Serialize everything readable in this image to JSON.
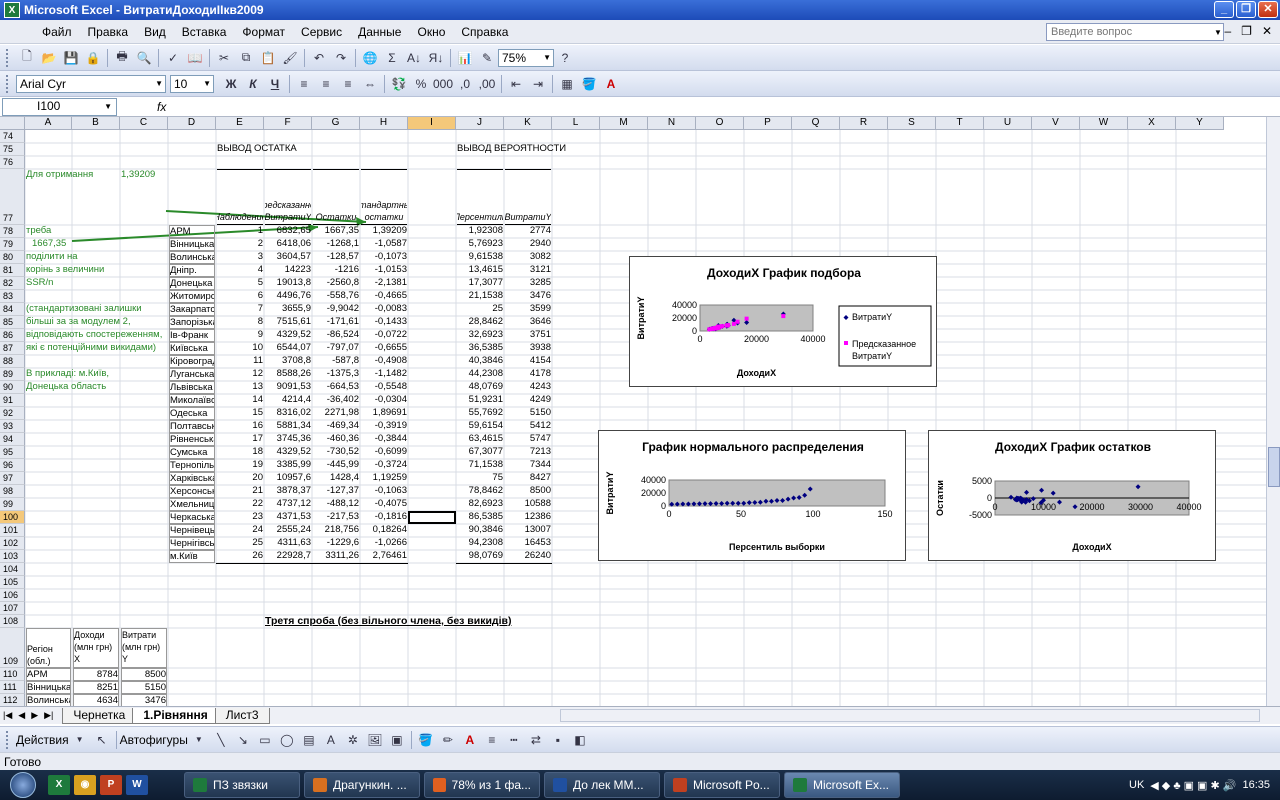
{
  "window": {
    "title": "Microsoft Excel - ВитратиДоходиІІкв2009"
  },
  "menu": [
    "Файл",
    "Правка",
    "Вид",
    "Вставка",
    "Формат",
    "Сервис",
    "Данные",
    "Окно",
    "Справка"
  ],
  "help": {
    "placeholder": "Введите вопрос"
  },
  "toolbar": {
    "zoom": "75%",
    "font": "Arial Cyr",
    "size": "10",
    "bold": "Ж",
    "italic": "К",
    "underline": "Ч"
  },
  "formula": {
    "namebox": "I100",
    "fx": "fx",
    "content": ""
  },
  "columns": [
    "A",
    "B",
    "C",
    "D",
    "E",
    "F",
    "G",
    "H",
    "I",
    "J",
    "K",
    "L",
    "M",
    "N",
    "O",
    "P",
    "Q",
    "R",
    "S",
    "T",
    "U",
    "V",
    "W",
    "X",
    "Y"
  ],
  "rows": [
    "74",
    "75",
    "76",
    "77",
    "78",
    "79",
    "80",
    "81",
    "82",
    "83",
    "84",
    "85",
    "86",
    "87",
    "88",
    "89",
    "90",
    "91",
    "92",
    "93",
    "94",
    "95",
    "96",
    "97",
    "98",
    "99",
    "100",
    "101",
    "102",
    "103",
    "104",
    "105",
    "106",
    "107",
    "108",
    "109",
    "110",
    "111",
    "112"
  ],
  "sheet": {
    "vyvod_ostatka": "ВЫВОД ОСТАТКА",
    "vyvod_veroyatnosti": "ВЫВОД ВЕРОЯТНОСТИ",
    "hdr_nabl": "Наблюдение",
    "hdr_pred": "Предсказанное ВитратиY",
    "hdr_ost": "Остатки",
    "hdr_std": "Стандартные остатки",
    "hdr_pers": "Персентиль",
    "hdr_vitr": "ВитратиY",
    "note": [
      "Для отримання",
      "треба",
      "поділити на",
      "корінь з величини",
      "SSR/n",
      "(стандартизовані залишки",
      " більші за за модулем 2,",
      "відповідають спостереженням,",
      "які є потенційними викидами)",
      "",
      "",
      "В прикладі: м.Київ,",
      "Донецька область"
    ],
    "note_b77": "1,39209",
    "note_a79": "1667,35",
    "regions": [
      "АРМ",
      "Вінницька",
      "Волинська",
      "Дніпр.",
      "Донецька",
      "Житомирська",
      "Закарпатська",
      "Запорізька",
      "Ів-Франк",
      "Київська",
      "Кіровоград",
      "Луганська",
      "Львівська",
      "Миколаївська",
      "Одеська",
      "Полтавська",
      "Рівненська",
      "Сумська",
      "Тернопільська",
      "Харківська",
      "Херсонська",
      "Хмельницька",
      "Черкаська",
      "Чернівецька",
      "Чернігівська",
      "м.Київ"
    ],
    "nabl": [
      "1",
      "2",
      "3",
      "4",
      "5",
      "6",
      "7",
      "8",
      "9",
      "10",
      "11",
      "12",
      "13",
      "14",
      "15",
      "16",
      "17",
      "18",
      "19",
      "20",
      "21",
      "22",
      "23",
      "24",
      "25",
      "26"
    ],
    "pred": [
      "6832,65",
      "6418,06",
      "3604,57",
      "14223",
      "19013,8",
      "4496,76",
      "3655,9",
      "7515,61",
      "4329,52",
      "6544,07",
      "3708,8",
      "8588,26",
      "9091,53",
      "4214,4",
      "8316,02",
      "5881,34",
      "3745,36",
      "4329,52",
      "3385,99",
      "10957,6",
      "3878,37",
      "4737,12",
      "4371,53",
      "2555,24",
      "4311,63",
      "22928,7"
    ],
    "ost": [
      "1667,35",
      "-1268,1",
      "-128,57",
      "-1216",
      "-2560,8",
      "-558,76",
      "-9,9042",
      "-171,61",
      "-86,524",
      "-797,07",
      "-587,8",
      "-1375,3",
      "-664,53",
      "-36,402",
      "2271,98",
      "-469,34",
      "-460,36",
      "-730,52",
      "-445,99",
      "1428,4",
      "-127,37",
      "-488,12",
      "-217,53",
      "218,756",
      "-1229,6",
      "3311,26"
    ],
    "std": [
      "1,39209",
      "-1,0587",
      "-0,1073",
      "-1,0153",
      "-2,1381",
      "-0,4665",
      "-0,0083",
      "-0,1433",
      "-0,0722",
      "-0,6655",
      "-0,4908",
      "-1,1482",
      "-0,5548",
      "-0,0304",
      "1,89691",
      "-0,3919",
      "-0,3844",
      "-0,6099",
      "-0,3724",
      "1,19259",
      "-0,1063",
      "-0,4075",
      "-0,1816",
      "0,18264",
      "-1,0266",
      "2,76461"
    ],
    "pers": [
      "1,92308",
      "5,76923",
      "9,61538",
      "13,4615",
      "17,3077",
      "21,1538",
      "25",
      "28,8462",
      "32,6923",
      "36,5385",
      "40,3846",
      "44,2308",
      "48,0769",
      "51,9231",
      "55,7692",
      "59,6154",
      "63,4615",
      "67,3077",
      "71,1538",
      "75",
      "78,8462",
      "82,6923",
      "86,5385",
      "90,3846",
      "94,2308",
      "98,0769"
    ],
    "vitr": [
      "2774",
      "2940",
      "3082",
      "3121",
      "3285",
      "3476",
      "3599",
      "3646",
      "3751",
      "3938",
      "4154",
      "4178",
      "4243",
      "4249",
      "5150",
      "5412",
      "5747",
      "7213",
      "7344",
      "8427",
      "8500",
      "10588",
      "12386",
      "13007",
      "16453",
      "26240"
    ],
    "third": "Третя спроба (без вільного члена, без викидів)",
    "t_region": "Регіон (обл.)",
    "t_doh": "Доходи (млн грн) X",
    "t_vit": "Витрати (млн грн) Y",
    "t_rows": [
      [
        "АРМ",
        "8784",
        "8500"
      ],
      [
        "Вінницька",
        "8251",
        "5150"
      ],
      [
        "Волинська",
        "4634",
        "3476"
      ]
    ]
  },
  "charts": [
    {
      "title": "ДоходиX График подбора",
      "xlabel": "ДоходиX",
      "ylabel": "ВитратиY",
      "legend": [
        "ВитратиY",
        "Предсказанное ВитратиY"
      ]
    },
    {
      "title": "График нормального распределения",
      "xlabel": "Персентиль выборки",
      "ylabel": "ВитратиY"
    },
    {
      "title": "ДоходиX График остатков",
      "xlabel": "ДоходиX",
      "ylabel": "Остатки"
    }
  ],
  "chart_data": [
    {
      "type": "scatter",
      "title": "ДоходиX График подбора",
      "xlabel": "ДоходиX",
      "ylabel": "ВитратиY",
      "xlim": [
        0,
        40000
      ],
      "ylim": [
        0,
        40000
      ],
      "xticks": [
        "0",
        "20000",
        "40000"
      ],
      "yticks": [
        "0",
        "20000",
        "40000"
      ],
      "series": [
        {
          "name": "ВитратиY",
          "x": [
            6500,
            6300,
            4700,
            13300,
            16500,
            5800,
            4500,
            7900,
            5300,
            7100,
            4500,
            9500,
            10000,
            5200,
            9600,
            6500,
            4700,
            5300,
            4200,
            12000,
            4800,
            6500,
            5500,
            3300,
            5500,
            29500
          ],
          "y": [
            8500,
            5150,
            3476,
            12386,
            13007,
            4243,
            3599,
            7344,
            4154,
            5747,
            3938,
            7213,
            8427,
            4178,
            10588,
            5412,
            4249,
            4178,
            3751,
            16453,
            3646,
            5150,
            4249,
            2774,
            3285,
            26240
          ]
        },
        {
          "name": "Предсказанное ВитратиY",
          "x": [
            6500,
            6300,
            4700,
            13300,
            16500,
            5800,
            4500,
            7900,
            5300,
            7100,
            4500,
            9500,
            10000,
            5200,
            9600,
            6500,
            4700,
            5300,
            4200,
            12000,
            4800,
            6500,
            5500,
            3300,
            5500,
            29500
          ],
          "y": [
            6833,
            6418,
            3605,
            14223,
            19014,
            4497,
            3656,
            7516,
            4330,
            6544,
            3709,
            8588,
            9092,
            4214,
            8316,
            5881,
            3745,
            4330,
            3386,
            10958,
            3878,
            4737,
            4372,
            2555,
            4312,
            22929
          ]
        }
      ]
    },
    {
      "type": "scatter",
      "title": "График нормального распределения",
      "xlabel": "Персентиль выборки",
      "ylabel": "ВитратиY",
      "xlim": [
        0,
        150
      ],
      "ylim": [
        0,
        40000
      ],
      "xticks": [
        "0",
        "50",
        "100",
        "150"
      ],
      "yticks": [
        "0",
        "20000",
        "40000"
      ],
      "series": [
        {
          "name": "",
          "x": [
            1.92,
            5.77,
            9.62,
            13.46,
            17.31,
            21.15,
            25,
            28.85,
            32.69,
            36.54,
            40.38,
            44.23,
            48.08,
            51.92,
            55.77,
            59.62,
            63.46,
            67.31,
            71.15,
            75,
            78.85,
            82.69,
            86.54,
            90.38,
            94.23,
            98.08
          ],
          "y": [
            2774,
            2940,
            3082,
            3121,
            3285,
            3476,
            3599,
            3646,
            3751,
            3938,
            4154,
            4178,
            4243,
            4249,
            5150,
            5412,
            5747,
            7213,
            7344,
            8427,
            8500,
            10588,
            12386,
            13007,
            16453,
            26240
          ]
        }
      ]
    },
    {
      "type": "scatter",
      "title": "ДоходиX График остатков",
      "xlabel": "ДоходиX",
      "ylabel": "Остатки",
      "xlim": [
        0,
        40000
      ],
      "ylim": [
        -5000,
        5000
      ],
      "xticks": [
        "0",
        "10000",
        "20000",
        "30000",
        "40000"
      ],
      "yticks": [
        "-5000",
        "0",
        "5000"
      ],
      "series": [
        {
          "name": "",
          "x": [
            6500,
            6300,
            4700,
            13300,
            16500,
            5800,
            4500,
            7900,
            5300,
            7100,
            4500,
            9500,
            10000,
            5200,
            9600,
            6500,
            4700,
            5300,
            4200,
            12000,
            4800,
            6500,
            5500,
            3300,
            5500,
            29500
          ],
          "y": [
            1667,
            -1268,
            -129,
            -1216,
            -2561,
            -559,
            -10,
            -172,
            -87,
            -797,
            -588,
            -1375,
            -665,
            -36,
            2272,
            -469,
            -460,
            -731,
            -446,
            1428,
            -127,
            -488,
            -218,
            219,
            -1230,
            3311
          ]
        }
      ]
    }
  ],
  "tabs": [
    "Чернетка",
    "1.Рівняння",
    "Лист3"
  ],
  "drawbar": {
    "actions": "Действия",
    "autoshapes": "Автофигуры"
  },
  "status": "Готово",
  "taskbar": {
    "items": [
      "ПЗ звязки",
      "Драгункин. ...",
      "78% из 1 фа...",
      "До лек ММ...",
      "Microsoft Po...",
      "Microsoft Ex..."
    ],
    "lang": "UK",
    "time": "16:35"
  }
}
